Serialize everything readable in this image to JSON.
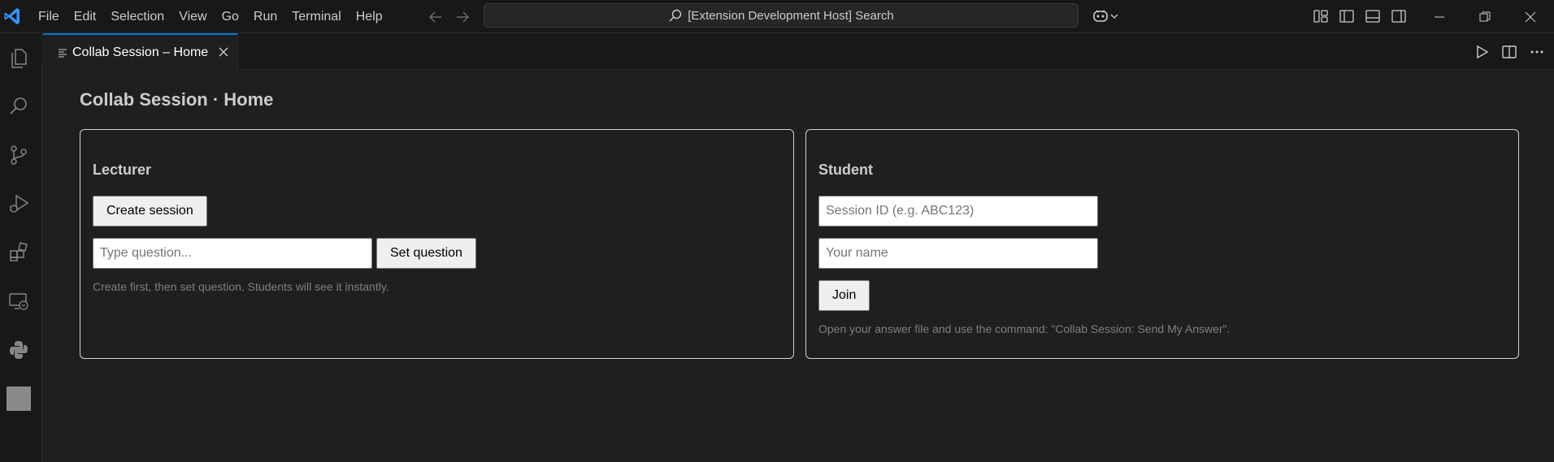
{
  "menu": [
    "File",
    "Edit",
    "Selection",
    "View",
    "Go",
    "Run",
    "Terminal",
    "Help"
  ],
  "search": {
    "text": "[Extension Development Host] Search"
  },
  "tab": {
    "label": "Collab Session – Home"
  },
  "page": {
    "title": "Collab Session · Home"
  },
  "lecturer": {
    "heading": "Lecturer",
    "create_button": "Create session",
    "question_placeholder": "Type question...",
    "set_button": "Set question",
    "hint": "Create first, then set question. Students will see it instantly."
  },
  "student": {
    "heading": "Student",
    "session_placeholder": "Session ID (e.g. ABC123)",
    "name_placeholder": "Your name",
    "join_button": "Join",
    "hint": "Open your answer file and use the command: \"Collab Session: Send My Answer\"."
  },
  "colors": {
    "accent": "#0078d4",
    "vscode_blue": "#3794ff",
    "border": "#d4d4d4"
  },
  "icons": [
    "vscode-logo-icon",
    "arrow-left-icon",
    "arrow-right-icon",
    "search-icon",
    "copilot-icon",
    "chevron-down-icon",
    "customize-layout-icon",
    "toggle-primary-sidebar-icon",
    "toggle-panel-icon",
    "toggle-secondary-sidebar-icon",
    "minimize-icon",
    "restore-icon",
    "close-icon",
    "explorer-icon",
    "search-view-icon",
    "source-control-icon",
    "run-debug-icon",
    "extensions-icon",
    "remote-explorer-icon",
    "python-icon",
    "preview-file-icon",
    "run-icon",
    "split-editor-icon",
    "more-actions-icon"
  ]
}
